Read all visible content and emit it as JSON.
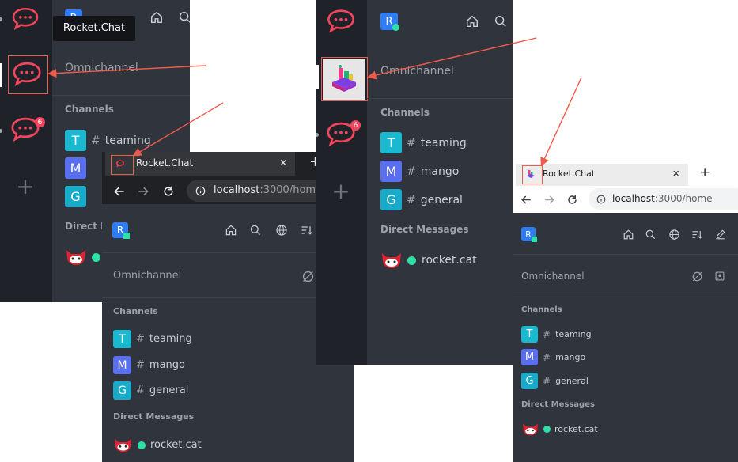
{
  "tooltip": "Rocket.Chat",
  "avatar_letter": "R",
  "omnichannel_label": "Omnichannel",
  "channels_header": "Channels",
  "direct_messages_header": "Direct Messages",
  "direct_messages_truncated": "Direct M",
  "channels": [
    {
      "letter": "T",
      "name": "teaming",
      "color": "#1bb9cf"
    },
    {
      "letter": "M",
      "name": "mango",
      "color": "#5a6ef0"
    },
    {
      "letter": "G",
      "name": "general",
      "color": "#17aac9"
    }
  ],
  "dm_user": "rocket.cat",
  "badge_count": "6",
  "browser": {
    "tab_title": "Rocket.Chat",
    "url_host": "localhost",
    "url_path_left": ":3000/home",
    "url_path_right": ":3000/home",
    "close_glyph": "✕",
    "new_tab_glyph": "+"
  },
  "colors": {
    "panel": "#2f343d",
    "rail": "#1f2329",
    "accent_red": "#f5455c",
    "online": "#2de0a5",
    "avatar_blue": "#2f7df6",
    "arrow": "#f05a4a"
  }
}
